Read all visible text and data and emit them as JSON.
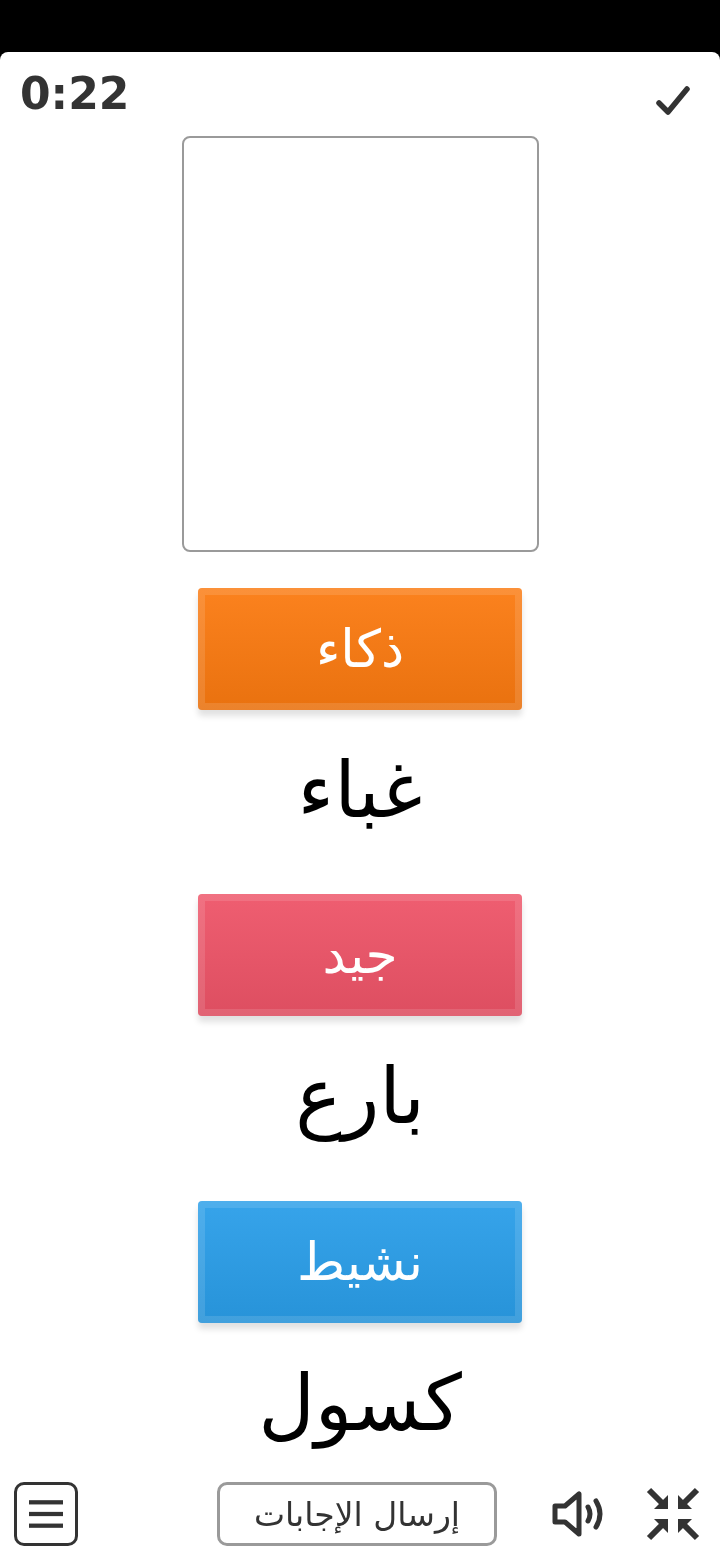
{
  "timer": "0:22",
  "items": [
    {
      "tile": {
        "label": "ذكاء",
        "color": "#fb7a10"
      },
      "word": "غباء"
    },
    {
      "tile": {
        "label": "جيد",
        "color": "#ee5468"
      },
      "word": "بارع"
    },
    {
      "tile": {
        "label": "نشيط",
        "color": "#2a9ee9"
      },
      "word": "كسول"
    }
  ],
  "submit_button": "إرسال الإجابات"
}
